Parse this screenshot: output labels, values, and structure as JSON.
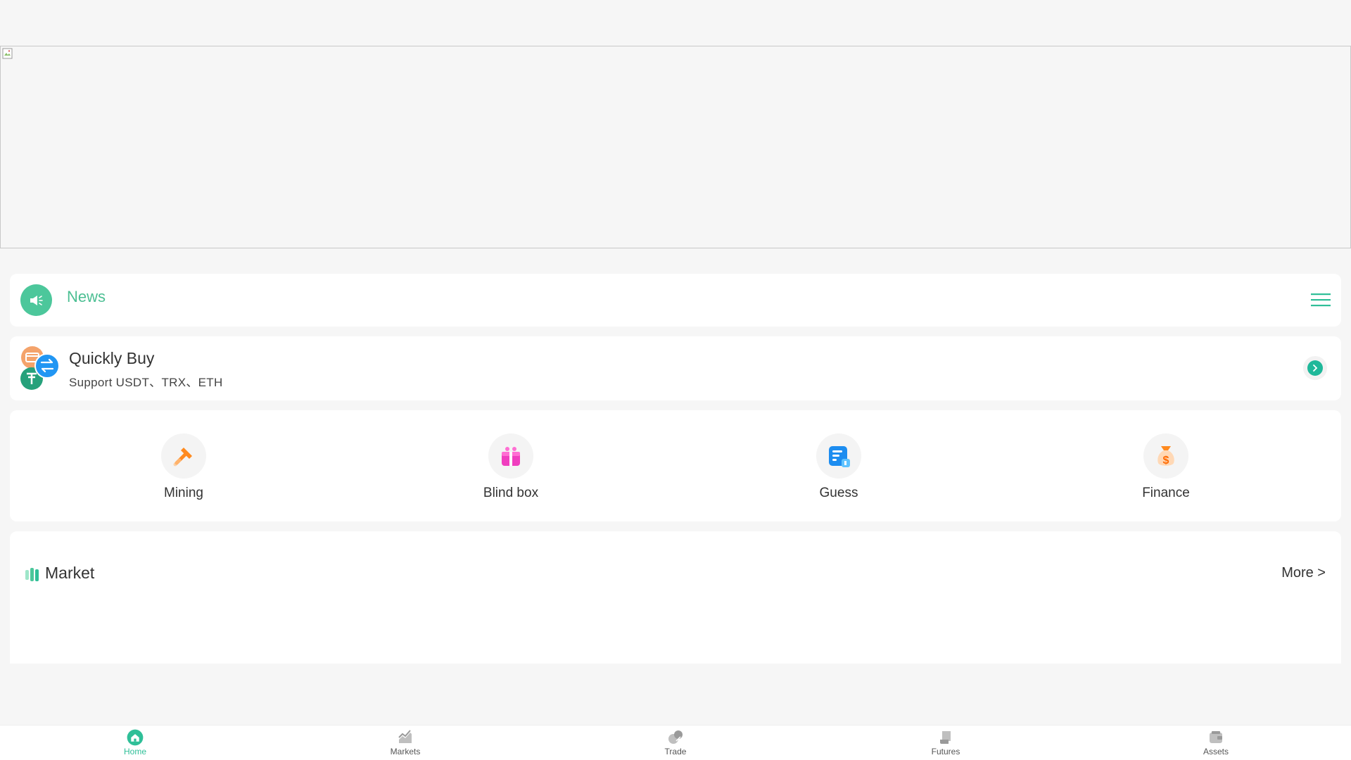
{
  "news": {
    "title": "News"
  },
  "quick_buy": {
    "title": "Quickly Buy",
    "subtitle": "Support USDT、TRX、ETH"
  },
  "features": [
    {
      "label": "Mining",
      "icon": "hammer-icon"
    },
    {
      "label": "Blind box",
      "icon": "gift-icon"
    },
    {
      "label": "Guess",
      "icon": "guess-icon"
    },
    {
      "label": "Finance",
      "icon": "money-bag-icon"
    }
  ],
  "market": {
    "title": "Market",
    "more_label": "More >"
  },
  "bottom_nav": {
    "items": [
      {
        "label": "Home",
        "icon": "home-icon",
        "active": true
      },
      {
        "label": "Markets",
        "icon": "chart-icon",
        "active": false
      },
      {
        "label": "Trade",
        "icon": "trade-icon",
        "active": false
      },
      {
        "label": "Futures",
        "icon": "futures-icon",
        "active": false
      },
      {
        "label": "Assets",
        "icon": "wallet-icon",
        "active": false
      }
    ]
  },
  "colors": {
    "accent": "#2fbf98",
    "background": "#f6f6f6",
    "card": "#ffffff"
  }
}
